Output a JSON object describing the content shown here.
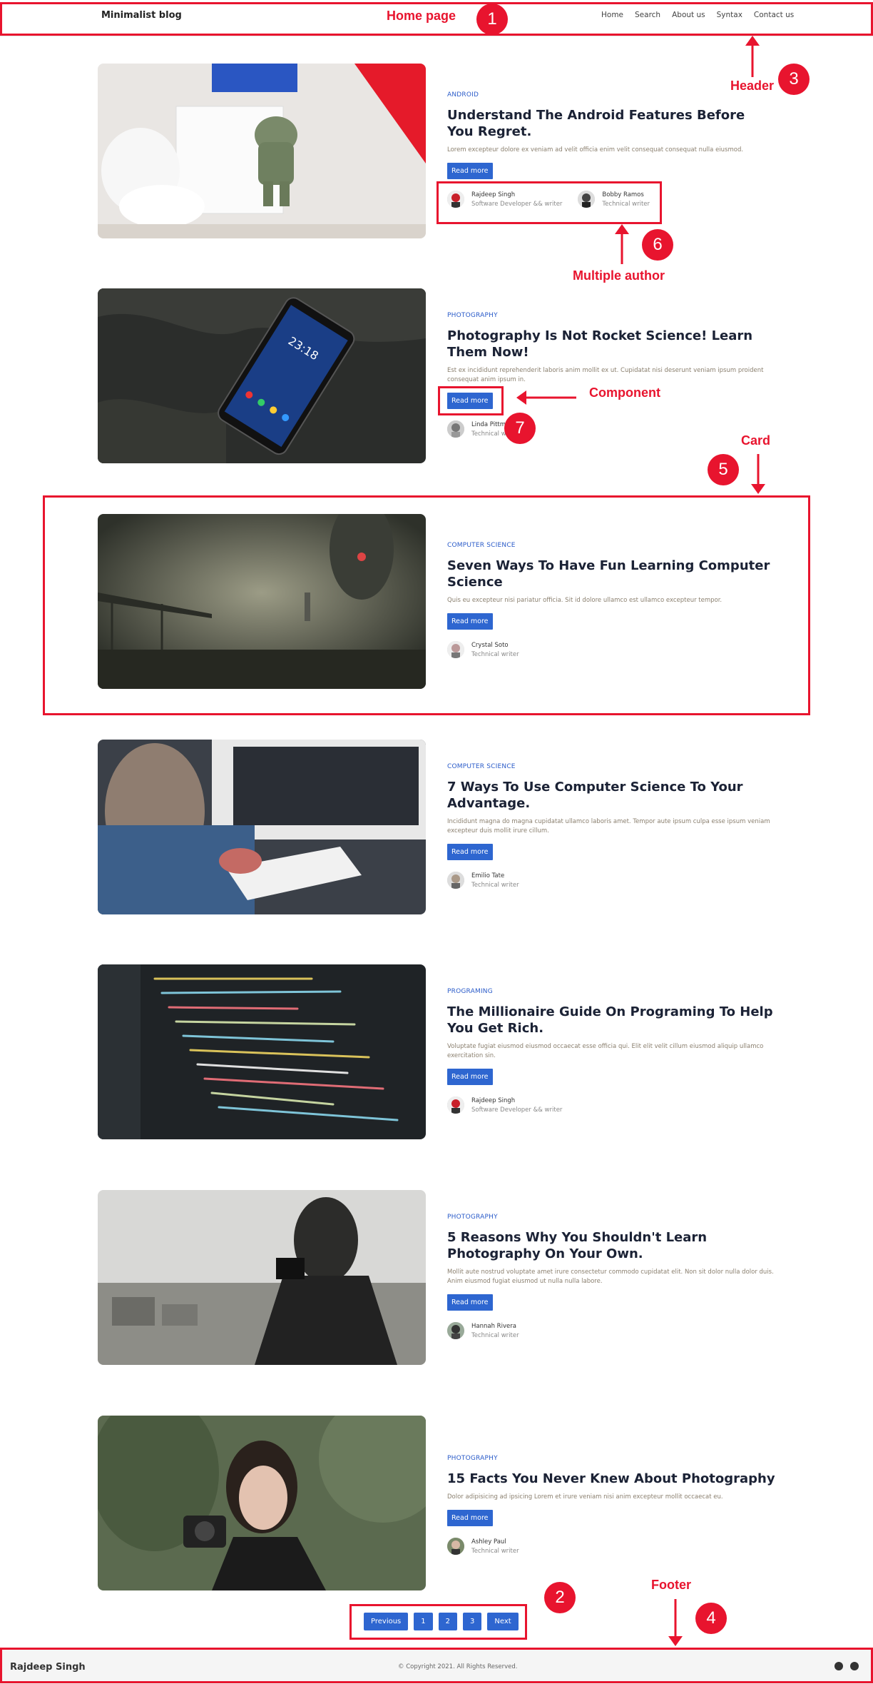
{
  "header": {
    "brand": "Minimalist blog",
    "nav": [
      "Home",
      "Search",
      "About us",
      "Syntax",
      "Contact us"
    ]
  },
  "annotations": {
    "home_page": "Home page",
    "header": "Header",
    "multiple_author": "Multiple author",
    "component": "Component",
    "card": "Card",
    "footer": "Footer",
    "numbers": [
      "1",
      "2",
      "3",
      "4",
      "5",
      "6",
      "7"
    ]
  },
  "posts": [
    {
      "category": "Android",
      "title": "Understand The Android Features Before You Regret.",
      "excerpt": "Lorem excepteur dolore ex veniam ad velit officia enim velit consequat consequat nulla eiusmod.",
      "button": "Read more",
      "authors": [
        {
          "name": "Rajdeep Singh",
          "role": "Software Developer && writer"
        },
        {
          "name": "Bobby Ramos",
          "role": "Technical writer"
        }
      ]
    },
    {
      "category": "Photography",
      "title": "Photography Is Not Rocket Science! Learn Them Now!",
      "excerpt": "Est ex incididunt reprehenderit laboris anim mollit ex ut. Cupidatat nisi deserunt veniam ipsum proident consequat anim ipsum in.",
      "button": "Read more",
      "authors": [
        {
          "name": "Linda Pittman",
          "role": "Technical writer"
        }
      ]
    },
    {
      "category": "Computer science",
      "title": "Seven Ways To Have Fun Learning Computer Science",
      "excerpt": "Quis eu excepteur nisi pariatur officia. Sit id dolore ullamco est ullamco excepteur tempor.",
      "button": "Read more",
      "authors": [
        {
          "name": "Crystal Soto",
          "role": "Technical writer"
        }
      ]
    },
    {
      "category": "Computer science",
      "title": "7 Ways To Use Computer Science To Your Advantage.",
      "excerpt": "Incididunt magna do magna cupidatat ullamco laboris amet. Tempor aute ipsum culpa esse ipsum veniam excepteur duis mollit irure cillum.",
      "button": "Read more",
      "authors": [
        {
          "name": "Emilio Tate",
          "role": "Technical writer"
        }
      ]
    },
    {
      "category": "Programing",
      "title": "The Millionaire Guide On Programing To Help You Get Rich.",
      "excerpt": "Voluptate fugiat eiusmod eiusmod occaecat esse officia qui. Elit elit velit cillum eiusmod aliquip ullamco exercitation sin.",
      "button": "Read more",
      "authors": [
        {
          "name": "Rajdeep Singh",
          "role": "Software Developer && writer"
        }
      ]
    },
    {
      "category": "Photography",
      "title": "5 Reasons Why You Shouldn't Learn Photography On Your Own.",
      "excerpt": "Mollit aute nostrud voluptate amet irure consectetur commodo cupidatat elit. Non sit dolor nulla dolor duis. Anim eiusmod fugiat eiusmod ut nulla nulla labore.",
      "button": "Read more",
      "authors": [
        {
          "name": "Hannah Rivera",
          "role": "Technical writer"
        }
      ]
    },
    {
      "category": "Photography",
      "title": "15 Facts You Never Knew About Photography",
      "excerpt": "Dolor adipisicing ad ipsicing Lorem et irure veniam nisi anim excepteur mollit occaecat eu.",
      "button": "Read more",
      "authors": [
        {
          "name": "Ashley Paul",
          "role": "Technical writer"
        }
      ]
    }
  ],
  "pagination": {
    "previous": "Previous",
    "pages": [
      "1",
      "2",
      "3"
    ],
    "next": "Next"
  },
  "footer": {
    "name": "Rajdeep Singh",
    "copyright": "© Copyright 2021. All Rights Reserved.",
    "icons": [
      "facebook-icon",
      "github-icon"
    ]
  },
  "colors": {
    "accent": "#2e66d0",
    "annotation": "#e8142e"
  }
}
